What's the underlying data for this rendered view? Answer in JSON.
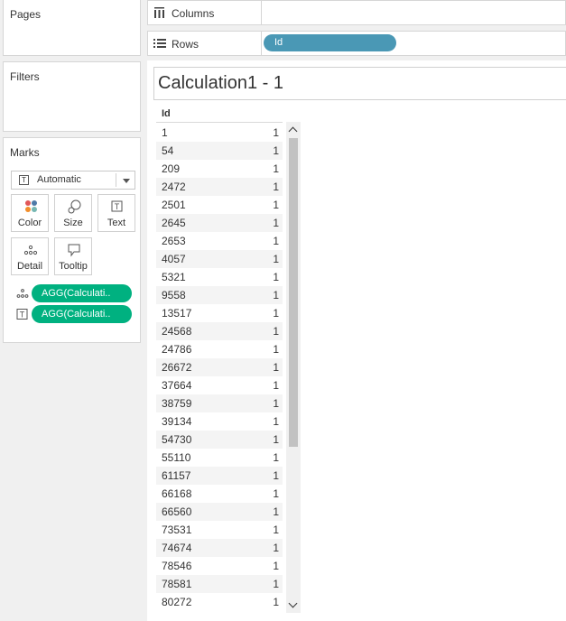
{
  "left": {
    "pages": {
      "title": "Pages"
    },
    "filters": {
      "title": "Filters"
    },
    "marks": {
      "title": "Marks",
      "type_dropdown": {
        "value": "Automatic",
        "icon": "text-mark-icon"
      },
      "buttons": [
        {
          "label": "Color",
          "icon": "color-dots-icon"
        },
        {
          "label": "Size",
          "icon": "size-icon"
        },
        {
          "label": "Text",
          "icon": "text-icon"
        },
        {
          "label": "Detail",
          "icon": "detail-dots-icon"
        },
        {
          "label": "Tooltip",
          "icon": "tooltip-icon"
        }
      ],
      "pills": [
        {
          "label": "AGG(Calculati..",
          "icon": "detail-dots-icon"
        },
        {
          "label": "AGG(Calculati..",
          "icon": "text-icon"
        }
      ]
    }
  },
  "shelves": {
    "columns": {
      "label": "Columns",
      "icon": "columns-icon"
    },
    "rows": {
      "label": "Rows",
      "icon": "rows-icon",
      "pill": "Id"
    }
  },
  "view": {
    "title": "Calculation1 - 1",
    "column_header": "Id",
    "rows": [
      {
        "id": "1",
        "value": "1"
      },
      {
        "id": "54",
        "value": "1"
      },
      {
        "id": "209",
        "value": "1"
      },
      {
        "id": "2472",
        "value": "1"
      },
      {
        "id": "2501",
        "value": "1"
      },
      {
        "id": "2645",
        "value": "1"
      },
      {
        "id": "2653",
        "value": "1"
      },
      {
        "id": "4057",
        "value": "1"
      },
      {
        "id": "5321",
        "value": "1"
      },
      {
        "id": "9558",
        "value": "1"
      },
      {
        "id": "13517",
        "value": "1"
      },
      {
        "id": "24568",
        "value": "1"
      },
      {
        "id": "24786",
        "value": "1"
      },
      {
        "id": "26672",
        "value": "1"
      },
      {
        "id": "37664",
        "value": "1"
      },
      {
        "id": "38759",
        "value": "1"
      },
      {
        "id": "39134",
        "value": "1"
      },
      {
        "id": "54730",
        "value": "1"
      },
      {
        "id": "55110",
        "value": "1"
      },
      {
        "id": "61157",
        "value": "1"
      },
      {
        "id": "66168",
        "value": "1"
      },
      {
        "id": "66560",
        "value": "1"
      },
      {
        "id": "73531",
        "value": "1"
      },
      {
        "id": "74674",
        "value": "1"
      },
      {
        "id": "78546",
        "value": "1"
      },
      {
        "id": "78581",
        "value": "1"
      },
      {
        "id": "80272",
        "value": "1"
      }
    ]
  },
  "colors": {
    "measure_pill": "#00b180",
    "dimension_pill": "#4a98b5"
  }
}
